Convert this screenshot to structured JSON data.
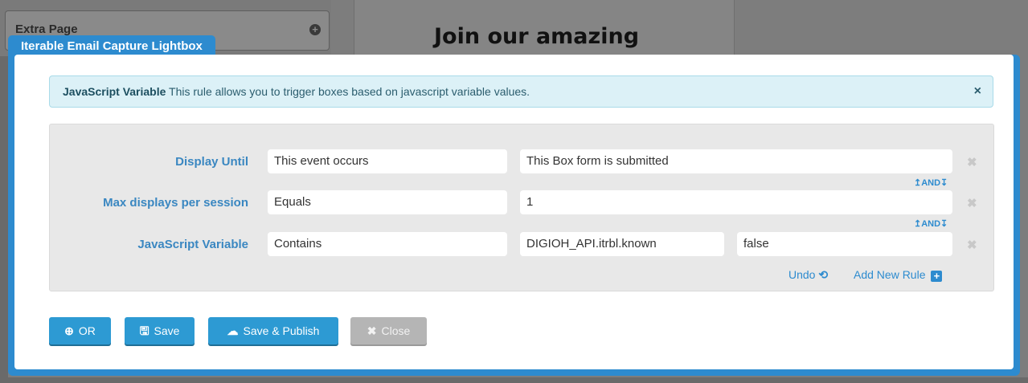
{
  "background": {
    "sidebar_label": "Extra Page",
    "preview_heading": "Join our amazing"
  },
  "modal": {
    "title": "Iterable Email Capture Lightbox",
    "alert": {
      "rule_name": "JavaScript Variable",
      "text": " This rule allows you to trigger boxes based on javascript variable values.",
      "close_icon": "×"
    },
    "rules": [
      {
        "label": "Display Until",
        "operator": "This event occurs",
        "value": "This Box form is submitted"
      },
      {
        "label": "Max displays per session",
        "operator": "Equals",
        "value": "1"
      },
      {
        "label": "JavaScript Variable",
        "operator": "Contains",
        "value": "DIGIOH_API.itrbl.known",
        "value2": "false"
      }
    ],
    "and_connector": "↥AND↧",
    "remove_icon": "✖",
    "undo_label": "Undo",
    "add_rule_label": "Add New Rule",
    "buttons": {
      "or": "OR",
      "save": "Save",
      "save_publish": "Save & Publish",
      "close": "Close"
    },
    "colors": {
      "accent": "#2d8bcf",
      "label": "#3a87c1",
      "alert_bg": "#dcf1f7"
    }
  }
}
